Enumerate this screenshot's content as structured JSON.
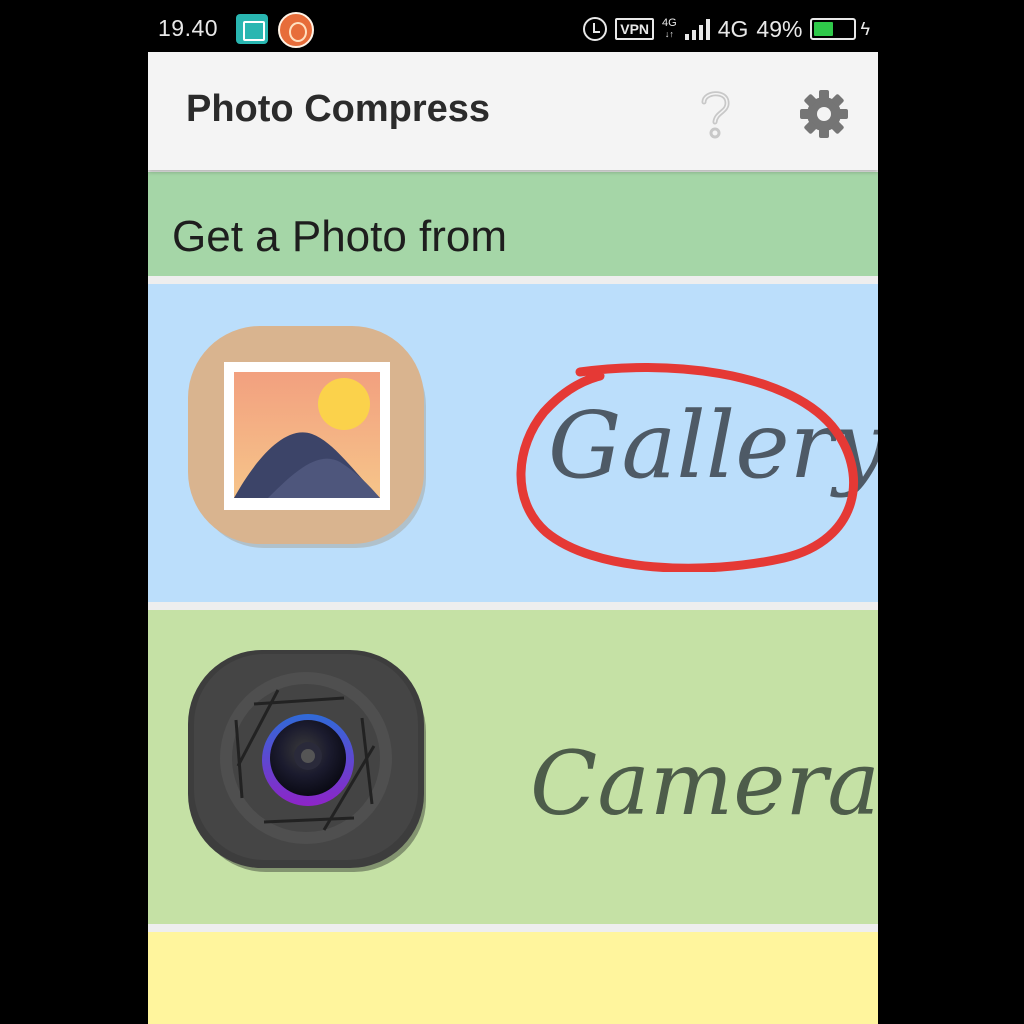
{
  "status_bar": {
    "time": "19.40",
    "vpn": "VPN",
    "network_small": "4G",
    "network": "4G",
    "battery": "49%",
    "battery_level": 0.49,
    "icons": [
      "screenshot-icon",
      "app-notification-icon",
      "alarm-icon",
      "vpn-icon",
      "signal-icon",
      "battery-icon",
      "charging-icon"
    ]
  },
  "toolbar": {
    "title": "Photo Compress",
    "help_icon": "help-icon",
    "settings_icon": "gear-icon"
  },
  "section": {
    "header": "Get a Photo from"
  },
  "options": {
    "gallery": {
      "label": "Gallery",
      "icon": "gallery-icon",
      "background": "#bbdefb",
      "highlighted": true,
      "highlight_color": "#e53935"
    },
    "camera": {
      "label": "Camera",
      "icon": "camera-icon",
      "background": "#c5e1a5"
    },
    "third": {
      "background": "#fff59d"
    }
  },
  "colors": {
    "header_bg": "#a5d6a7",
    "toolbar_bg": "#f4f4f4"
  }
}
